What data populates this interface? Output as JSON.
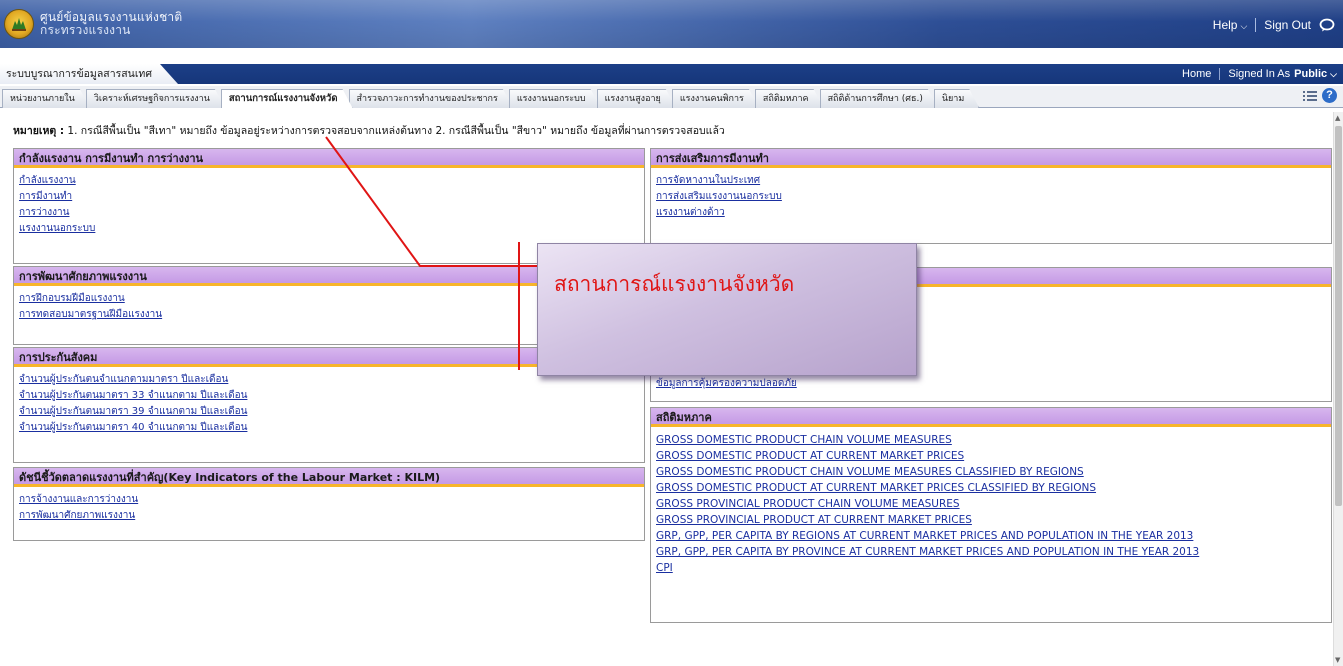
{
  "header": {
    "logo_line1": "ศูนย์ข้อมูลแรงงานแห่งชาติ",
    "logo_line2": "กระทรวงแรงงาน",
    "help_label": "Help",
    "signout_label": "Sign Out"
  },
  "sysbar": {
    "title": "ระบบบูรณาการข้อมูลสารสนเทศ",
    "home_label": "Home",
    "signed_in_label": "Signed In As",
    "user": "Public"
  },
  "tabs": [
    {
      "label": "หน่วยงานภายใน"
    },
    {
      "label": "วิเคราะห์เศรษฐกิจการแรงงาน"
    },
    {
      "label": "สถานการณ์แรงงานจังหวัด"
    },
    {
      "label": "สำรวจภาวะการทำงานของประชากร"
    },
    {
      "label": "แรงงานนอกระบบ"
    },
    {
      "label": "แรงงานสูงอายุ"
    },
    {
      "label": "แรงงานคนพิการ"
    },
    {
      "label": "สถิติมหภาค"
    },
    {
      "label": "สถิติด้านการศึกษา (ศธ.)"
    },
    {
      "label": "นิยาม"
    }
  ],
  "note": {
    "label": "หมายเหตุ :",
    "text": " 1. กรณีสีพื้นเป็น \"สีเทา\" หมายถึง ข้อมูลอยู่ระหว่างการตรวจสอบจากแหล่งต้นทาง 2. กรณีสีพื้นเป็น \"สีขาว\" หมายถึง ข้อมูลที่ผ่านการตรวจสอบแล้ว"
  },
  "sections": {
    "labor_force": {
      "title": "กำลังแรงงาน การมีงานทำ การว่างงาน",
      "links": [
        "กำลังแรงงาน",
        "การมีงานทำ",
        "การว่างงาน",
        "แรงงานนอกระบบ"
      ]
    },
    "skill_dev": {
      "title": "การพัฒนาศักยภาพแรงงาน",
      "links": [
        "การฝึกอบรมฝีมือแรงงาน",
        "การทดสอบมาตรฐานฝีมือแรงงาน"
      ]
    },
    "social_security": {
      "title": "การประกันสังคม",
      "links": [
        "จำนวนผู้ประกันตนจำแนกตามมาตรา ปีและเดือน",
        "จำนวนผู้ประกันตนมาตรา 33 จำแนกตาม ปีและเดือน",
        "จำนวนผู้ประกันตนมาตรา 39 จำแนกตาม ปีและเดือน",
        "จำนวนผู้ประกันตนมาตรา 40 จำแนกตาม ปีและเดือน"
      ]
    },
    "kilm": {
      "title": "ดัชนีชี้วัดตลาดแรงงานที่สำคัญ(Key Indicators of the Labour Market : KILM)",
      "links": [
        "การจ้างงานและการว่างงาน",
        "การพัฒนาศักยภาพแรงงาน"
      ]
    },
    "employment_promo": {
      "title": "การส่งเสริมการมีงานทำ",
      "links": [
        "การจัดหางานในประเทศ",
        "การส่งเสริมแรงงานนอกระบบ",
        "แรงงานต่างด้าว"
      ]
    },
    "labor_protection": {
      "title": "",
      "links": [
        "ข้อมูลการคุ้มครองความปลอดภัย"
      ]
    },
    "macro": {
      "title": "สถิติมหภาค",
      "links": [
        "GROSS DOMESTIC PRODUCT CHAIN VOLUME MEASURES",
        "GROSS DOMESTIC PRODUCT AT CURRENT MARKET PRICES",
        "GROSS DOMESTIC PRODUCT CHAIN VOLUME MEASURES CLASSIFIED BY REGIONS",
        "GROSS DOMESTIC PRODUCT AT CURRENT MARKET PRICES CLASSIFIED BY REGIONS",
        "GROSS PROVINCIAL PRODUCT CHAIN VOLUME MEASURES",
        "GROSS PROVINCIAL PRODUCT AT CURRENT MARKET PRICES",
        "GRP, GPP, PER CAPITA BY REGIONS AT CURRENT MARKET PRICES AND POPULATION IN THE YEAR 2013",
        "GRP, GPP, PER CAPITA BY PROVINCE AT CURRENT MARKET PRICES AND POPULATION IN THE YEAR 2013",
        "CPI"
      ]
    }
  },
  "callout": {
    "text": "สถานการณ์แรงงานจังหวัด",
    "color": "#e01515"
  },
  "colors": {
    "header_blue": "#2e4f96",
    "section_head": "#c59ae5",
    "section_accent": "#f7b52b",
    "link": "#1a2fa0"
  }
}
